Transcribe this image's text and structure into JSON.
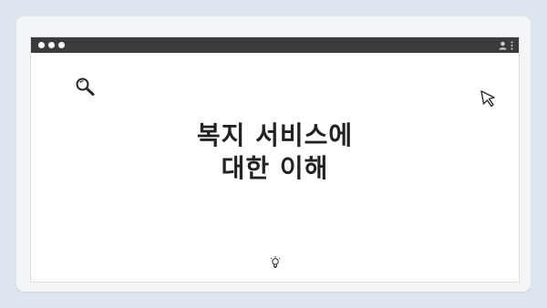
{
  "window": {
    "controls": [
      "close-dot",
      "minimize-dot",
      "maximize-dot"
    ]
  },
  "slide": {
    "title_line1": "복지 서비스에",
    "title_line2": "대한 이해"
  },
  "icons": {
    "search": "search-icon",
    "cursor": "cursor-icon",
    "lightbulb": "lightbulb-icon",
    "user": "user-icon",
    "menu": "more-vertical-icon"
  },
  "colors": {
    "background": "#dde5ee",
    "titlebar": "#3b3b3d",
    "page": "#ffffff",
    "text": "#222222"
  }
}
